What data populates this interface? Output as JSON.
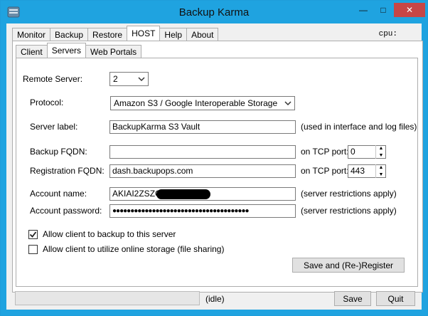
{
  "window": {
    "title": "Backup Karma",
    "controls": {
      "minimize": "—",
      "maximize": "□",
      "close": "✕"
    }
  },
  "tabs": [
    {
      "label": "Monitor"
    },
    {
      "label": "Backup"
    },
    {
      "label": "Restore"
    },
    {
      "label": "HOST",
      "active": true
    },
    {
      "label": "Help"
    },
    {
      "label": "About"
    }
  ],
  "cpu_label": "cpu:",
  "subtabs": [
    {
      "label": "Client"
    },
    {
      "label": "Servers",
      "active": true
    },
    {
      "label": "Web Portals"
    }
  ],
  "form": {
    "remote_server": {
      "label": "Remote Server:",
      "value": "2"
    },
    "protocol": {
      "label": "Protocol:",
      "value": "Amazon S3 / Google Interoperable Storage"
    },
    "server_label": {
      "label": "Server label:",
      "value": "BackupKarma S3 Vault",
      "note": "(used in interface and log files)"
    },
    "backup_fqdn": {
      "label": "Backup FQDN:",
      "value": "",
      "port_label": "on TCP port:",
      "port": "0"
    },
    "registration_fqdn": {
      "label": "Registration FQDN:",
      "value": "dash.backupops.com",
      "port_label": "on TCP port:",
      "port": "443"
    },
    "account_name": {
      "label": "Account name:",
      "value": "AKIAI2ZSZG",
      "note": "(server restrictions apply)"
    },
    "account_password": {
      "label": "Account password:",
      "value": "●●●●●●●●●●●●●●●●●●●●●●●●●●●●●●●●●●●●●●",
      "note": "(server restrictions apply)"
    },
    "allow_backup": {
      "label": "Allow client to backup to this server",
      "checked": true
    },
    "allow_storage": {
      "label": "Allow client to utilize online storage (file sharing)",
      "checked": false
    },
    "register_button": "Save and (Re-)Register"
  },
  "footer": {
    "progress": 0,
    "status": "(idle)",
    "save_button": "Save",
    "quit_button": "Quit"
  },
  "colors": {
    "titlebar": "#1fa3e0",
    "close_button": "#c74646"
  }
}
